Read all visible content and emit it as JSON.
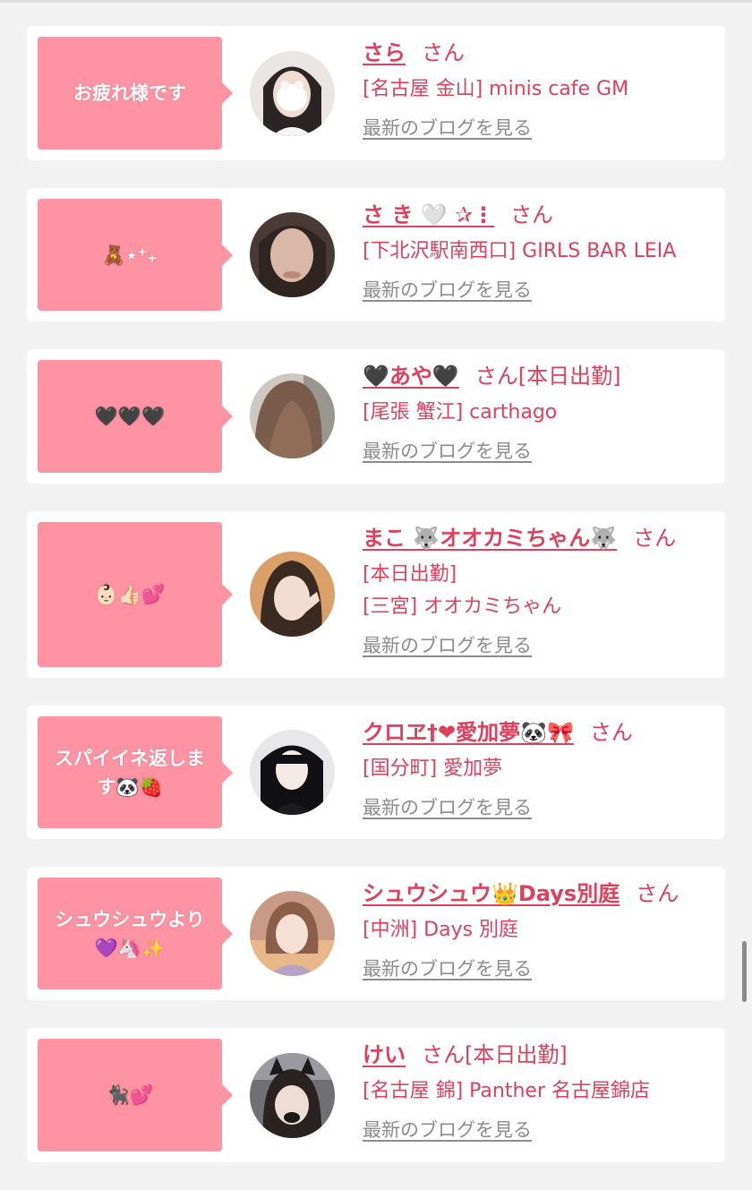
{
  "entries": [
    {
      "bubble": "お疲れ様です",
      "name": "さら",
      "san": "さん",
      "tag": "",
      "status_line": "",
      "shop": "[名古屋 金山] minis cafe GM",
      "blog": "最新のブログを見る",
      "avatar_color": "#3a3232"
    },
    {
      "bubble": "🧸⋆⁺₊",
      "name": "さ き 🤍 ✰⋮",
      "san": "さん",
      "tag": "",
      "status_line": "",
      "shop": "[下北沢駅南西口] GIRLS BAR LEIA",
      "blog": "最新のブログを見る",
      "avatar_color": "#5b4a44"
    },
    {
      "bubble": "🖤🖤🖤",
      "name": "🖤あや🖤",
      "san": "さん",
      "tag": "[本日出勤]",
      "status_line": "",
      "shop": "[尾張 蟹江] carthago",
      "blog": "最新のブログを見る",
      "avatar_color": "#7b6254"
    },
    {
      "bubble": "👶🏻👍🏻💕",
      "name": "まこ 🐺オオカミちゃん🐺",
      "san": "さん",
      "tag": "",
      "status_line": "[本日出勤]",
      "shop": "[三宮] オオカミちゃん",
      "blog": "最新のブログを見る",
      "avatar_color": "#c08a58"
    },
    {
      "bubble": "スパイイネ返します🐼🍓",
      "name": "クロヱ†❤愛加夢🐼🎀",
      "san": "さん",
      "tag": "",
      "status_line": "",
      "shop": "[国分町] 愛加夢",
      "blog": "最新のブログを見る",
      "avatar_color": "#2a2a2e"
    },
    {
      "bubble": "シュウシュウより💜🦄✨",
      "name": "シュウシュウ👑Days別庭",
      "san": "さん",
      "tag": "",
      "status_line": "",
      "shop": "[中洲] Days 別庭",
      "blog": "最新のブログを見る",
      "avatar_color": "#a37f78"
    },
    {
      "bubble": "🐈‍⬛💕",
      "name": "けい",
      "san": "さん",
      "tag": "[本日出勤]",
      "status_line": "",
      "shop": "[名古屋 錦] Panther 名古屋錦店",
      "blog": "最新のブログを見る",
      "avatar_color": "#4a4a4f"
    }
  ]
}
